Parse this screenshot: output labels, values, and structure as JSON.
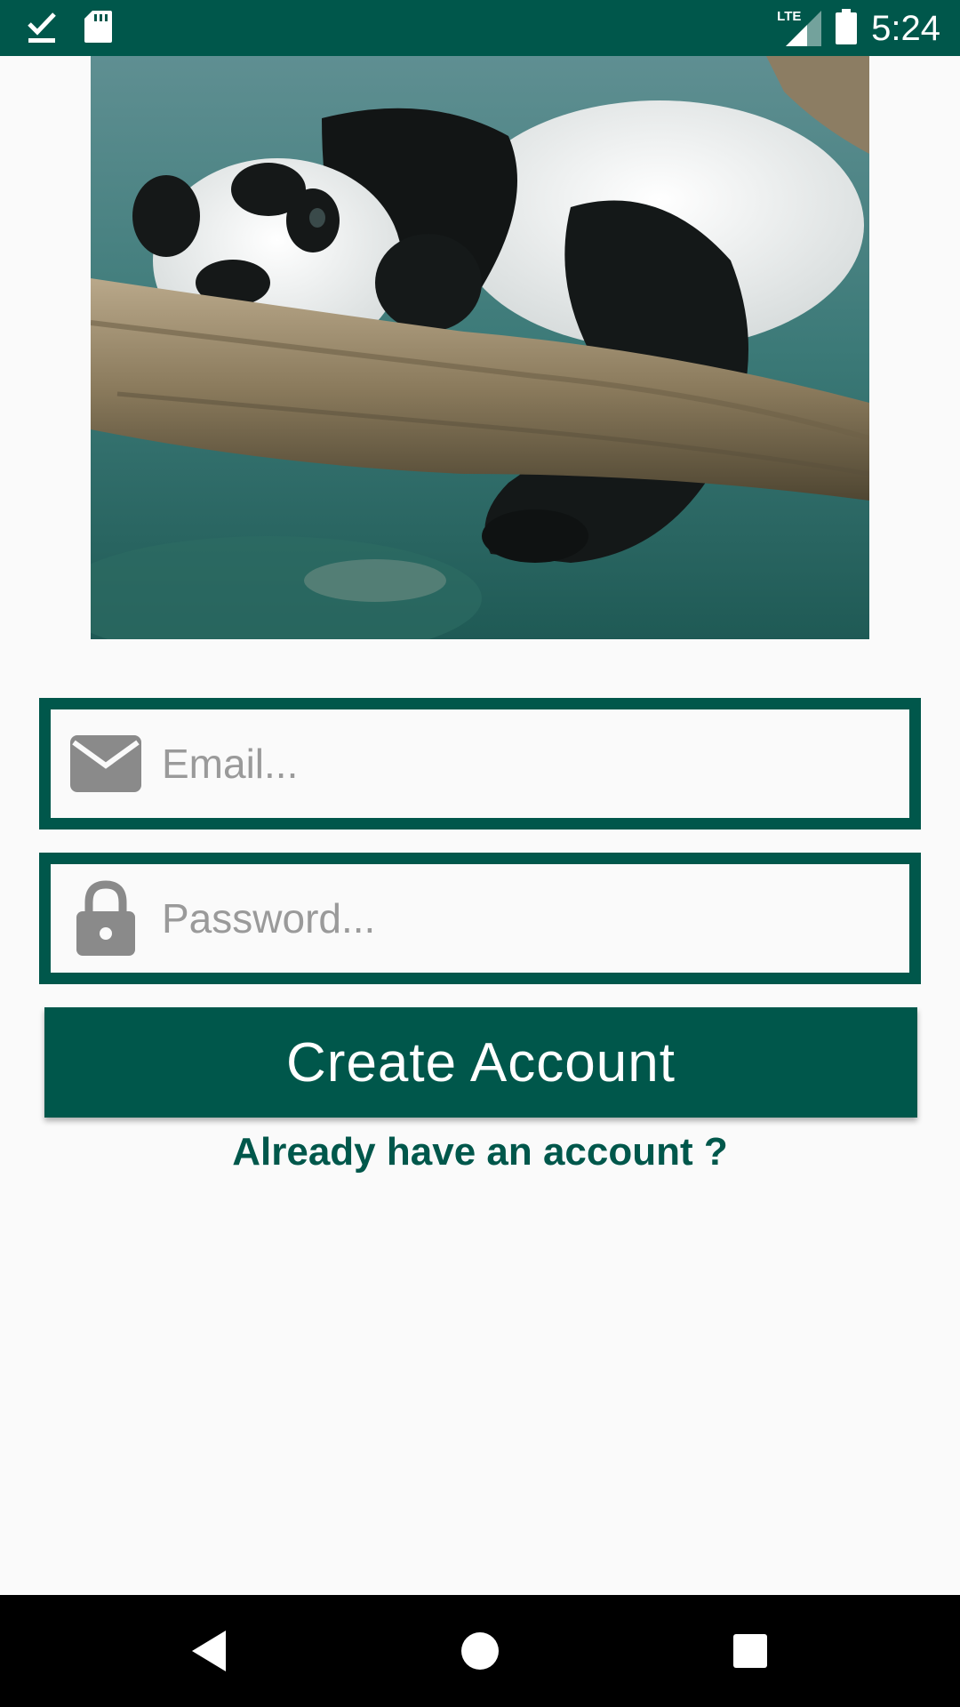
{
  "status_bar": {
    "time": "5:24",
    "network_label": "LTE",
    "left_icons": [
      "download-done-icon",
      "sd-card-icon"
    ],
    "right_icons": [
      "signal-icon",
      "battery-icon"
    ]
  },
  "hero_image": {
    "subject": "sleeping panda on a tree branch"
  },
  "form": {
    "email": {
      "placeholder": "Email...",
      "value": "",
      "icon": "email-icon"
    },
    "password": {
      "placeholder": "Password...",
      "value": "",
      "icon": "lock-icon"
    },
    "create_button_label": "Create Account",
    "login_link_label": "Already have an account ?"
  },
  "navigation_bar": {
    "buttons": [
      "back-icon",
      "home-icon",
      "recents-icon"
    ]
  },
  "colors": {
    "primary": "#00574b",
    "background": "#fafafa",
    "placeholder": "#9a9a9a",
    "icon_gray": "#8a8a8a"
  }
}
